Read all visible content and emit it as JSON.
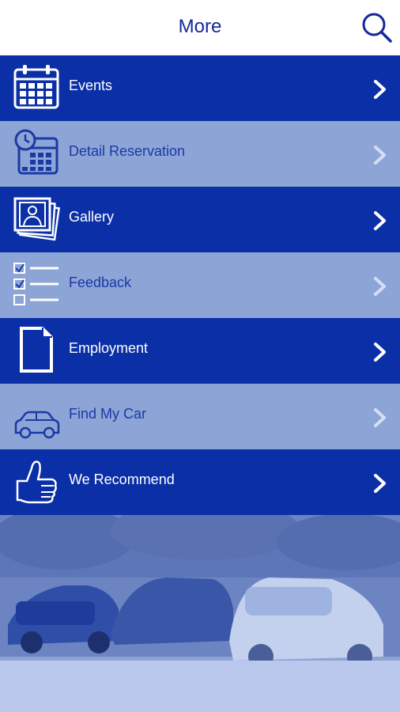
{
  "header": {
    "title": "More",
    "search_icon": "search-icon"
  },
  "menu": {
    "items": [
      {
        "label": "Events",
        "icon": "calendar-icon",
        "style": "dark"
      },
      {
        "label": "Detail Reservation",
        "icon": "calendar-clock-icon",
        "style": "light"
      },
      {
        "label": "Gallery",
        "icon": "photo-gallery-icon",
        "style": "dark"
      },
      {
        "label": "Feedback",
        "icon": "checklist-icon",
        "style": "light"
      },
      {
        "label": "Employment",
        "icon": "document-icon",
        "style": "dark"
      },
      {
        "label": "Find My Car",
        "icon": "car-icon",
        "style": "light"
      },
      {
        "label": "We Recommend",
        "icon": "thumbs-up-icon",
        "style": "dark"
      }
    ]
  },
  "colors": {
    "brand": "#0b2fa6",
    "light_row": "#8ca4d6",
    "header_text": "#13289a"
  }
}
